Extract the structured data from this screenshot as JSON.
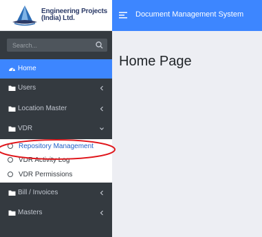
{
  "brand": {
    "name_line1": "Engineering Projects",
    "name_line2": "(India) Ltd."
  },
  "header": {
    "title": "Document Management System",
    "menu_icon": "hamburger-icon"
  },
  "search": {
    "placeholder": "Search...",
    "icon": "search-icon"
  },
  "sidebar": {
    "items": [
      {
        "label": "Home",
        "icon": "dashboard-icon",
        "active": true
      },
      {
        "label": "Users",
        "icon": "folder-icon",
        "has_chevron": true
      },
      {
        "label": "Location Master",
        "icon": "folder-icon",
        "has_chevron": true
      },
      {
        "label": "VDR",
        "icon": "folder-icon",
        "expanded": true
      },
      {
        "label": "Bill / Invoices",
        "icon": "folder-icon",
        "has_chevron": true
      },
      {
        "label": "Masters",
        "icon": "folder-icon",
        "has_chevron": true
      }
    ],
    "vdr_submenu": [
      {
        "label": "Repository Management"
      },
      {
        "label": "VDR Activity Log"
      },
      {
        "label": "VDR Permissions"
      }
    ]
  },
  "main": {
    "page_title": "Home Page"
  },
  "colors": {
    "accent": "#3d86ff",
    "sidebar_bg": "#343a40",
    "annotation": "#e0161b"
  }
}
